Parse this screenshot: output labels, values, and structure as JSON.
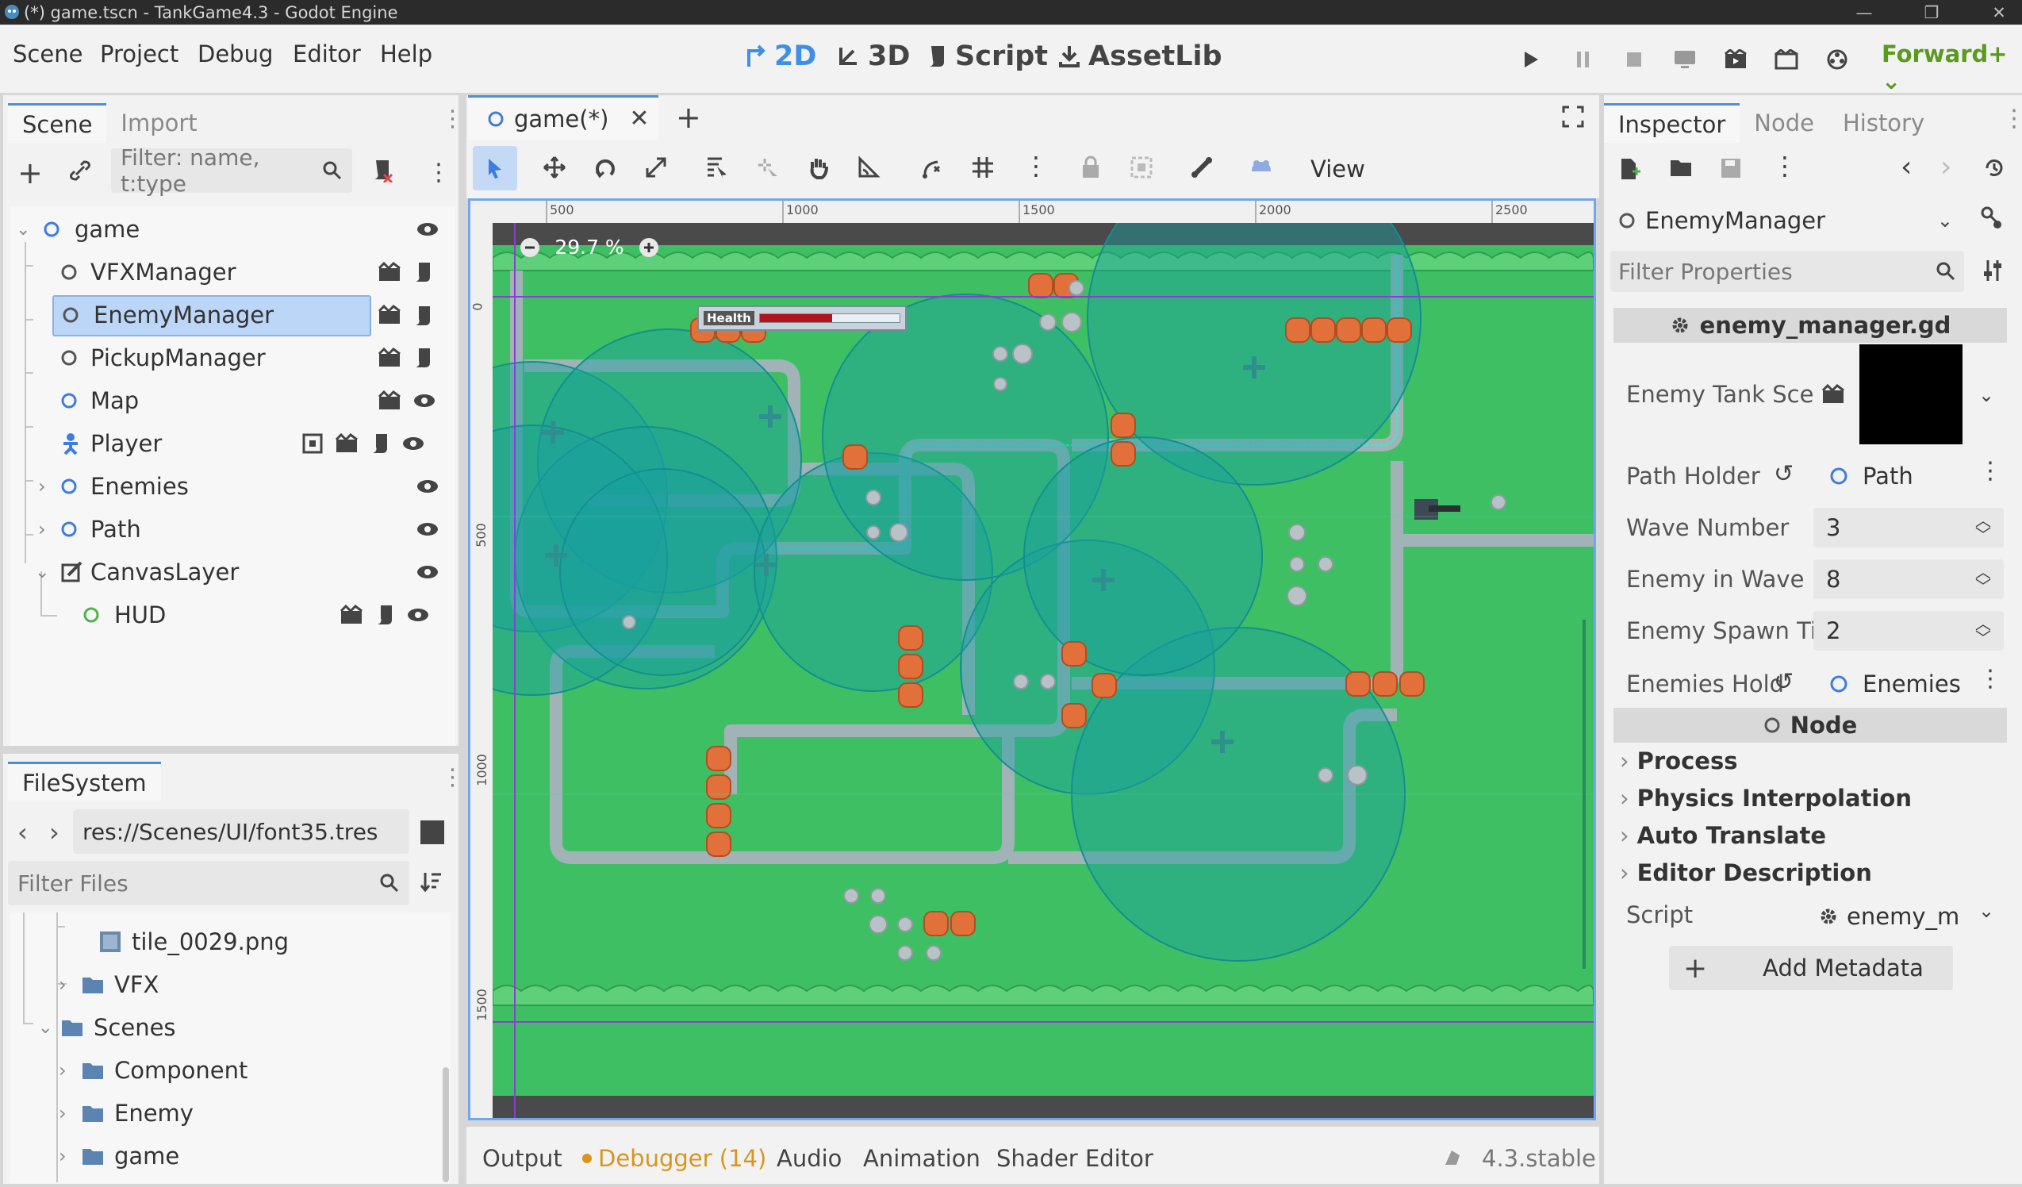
{
  "window": {
    "title": "(*) game.tscn - TankGame4.3 - Godot Engine"
  },
  "menu": {
    "items": [
      "Scene",
      "Project",
      "Debug",
      "Editor",
      "Help"
    ]
  },
  "workspaces": {
    "w2d": "2D",
    "w3d": "3D",
    "script": "Script",
    "assetlib": "AssetLib"
  },
  "renderer": "Forward+",
  "scene_dock": {
    "tabs": [
      "Scene",
      "Import"
    ],
    "filter_placeholder": "Filter: name, t:type",
    "nodes": [
      {
        "label": "game"
      },
      {
        "label": "VFXManager"
      },
      {
        "label": "EnemyManager"
      },
      {
        "label": "PickupManager"
      },
      {
        "label": "Map"
      },
      {
        "label": "Player"
      },
      {
        "label": "Enemies"
      },
      {
        "label": "Path"
      },
      {
        "label": "CanvasLayer"
      },
      {
        "label": "HUD"
      }
    ]
  },
  "filesystem": {
    "tab": "FileSystem",
    "path": "res://Scenes/UI/font35.tres",
    "filter_placeholder": "Filter Files",
    "items": [
      {
        "label": "tile_0029.png"
      },
      {
        "label": "VFX"
      },
      {
        "label": "Scenes"
      },
      {
        "label": "Component"
      },
      {
        "label": "Enemy"
      },
      {
        "label": "game"
      }
    ]
  },
  "editor_tab": {
    "label": "game(*)"
  },
  "toolbar": {
    "view_label": "View"
  },
  "viewport": {
    "zoom": "29.7 %",
    "ruler_labels": [
      "500",
      "1000",
      "1500",
      "2000",
      "2500"
    ],
    "ruler_v_labels": [
      "0",
      "500",
      "1000",
      "1500"
    ],
    "health_label": "Health"
  },
  "bottom_panel": {
    "tabs": [
      "Output",
      "Debugger (14)",
      "Audio",
      "Animation",
      "Shader Editor"
    ],
    "version": "4.3.stable"
  },
  "inspector": {
    "tabs": [
      "Inspector",
      "Node",
      "History"
    ],
    "object": "EnemyManager",
    "filter_placeholder": "Filter Properties",
    "script_header": "enemy_manager.gd",
    "props": {
      "enemy_tank_scene": "Enemy Tank Sce",
      "path_holder": "Path Holder",
      "path_holder_val": "Path",
      "wave_number": "Wave Number",
      "wave_number_val": "3",
      "enemy_in_wave": "Enemy in Wave",
      "enemy_in_wave_val": "8",
      "enemy_spawn": "Enemy Spawn Ti",
      "enemy_spawn_val": "2",
      "enemies_holder": "Enemies Hold",
      "enemies_holder_val": "Enemies"
    },
    "node_section": "Node",
    "subsections": [
      "Process",
      "Physics Interpolation",
      "Auto Translate",
      "Editor Description"
    ],
    "script_label": "Script",
    "script_val": "enemy_m",
    "add_metadata": "Add Metadata"
  },
  "colors": {
    "accent": "#4c8de0",
    "grass": "#3fbf63",
    "crate": "#e2703a",
    "renderer": "#5a9a1e",
    "debugger": "#d9951f"
  }
}
